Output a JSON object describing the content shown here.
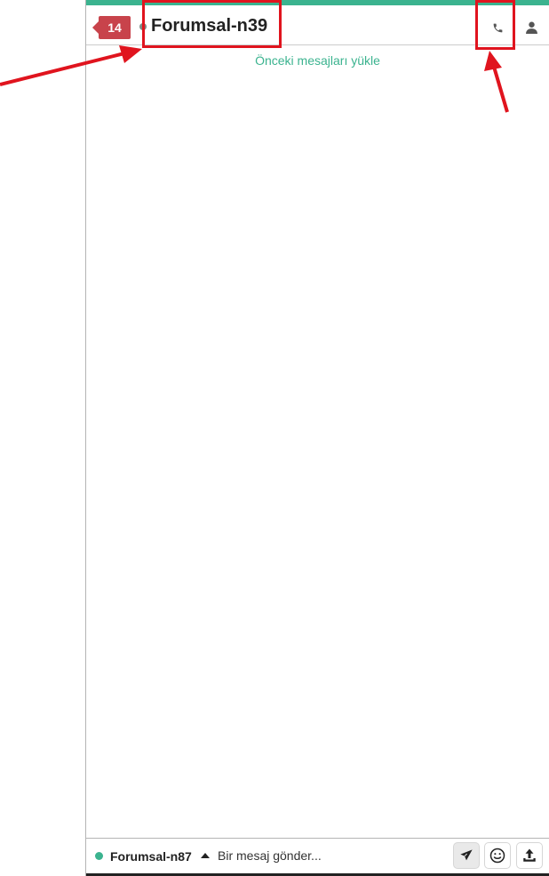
{
  "header": {
    "badge_count": "14",
    "contact_name": "Forumsal-n39",
    "call_icon": "phone-icon",
    "profile_icon": "user-icon"
  },
  "messages": {
    "load_previous": "Önceki mesajları yükle"
  },
  "footer": {
    "user_name": "Forumsal-n87",
    "message_placeholder": "Bir mesaj gönder...",
    "send_icon": "paper-plane-icon",
    "emoji_icon": "smiley-icon",
    "upload_icon": "upload-icon"
  },
  "colors": {
    "accent": "#3bb38f",
    "badge": "#c8434b",
    "annotation": "#e0141e"
  }
}
